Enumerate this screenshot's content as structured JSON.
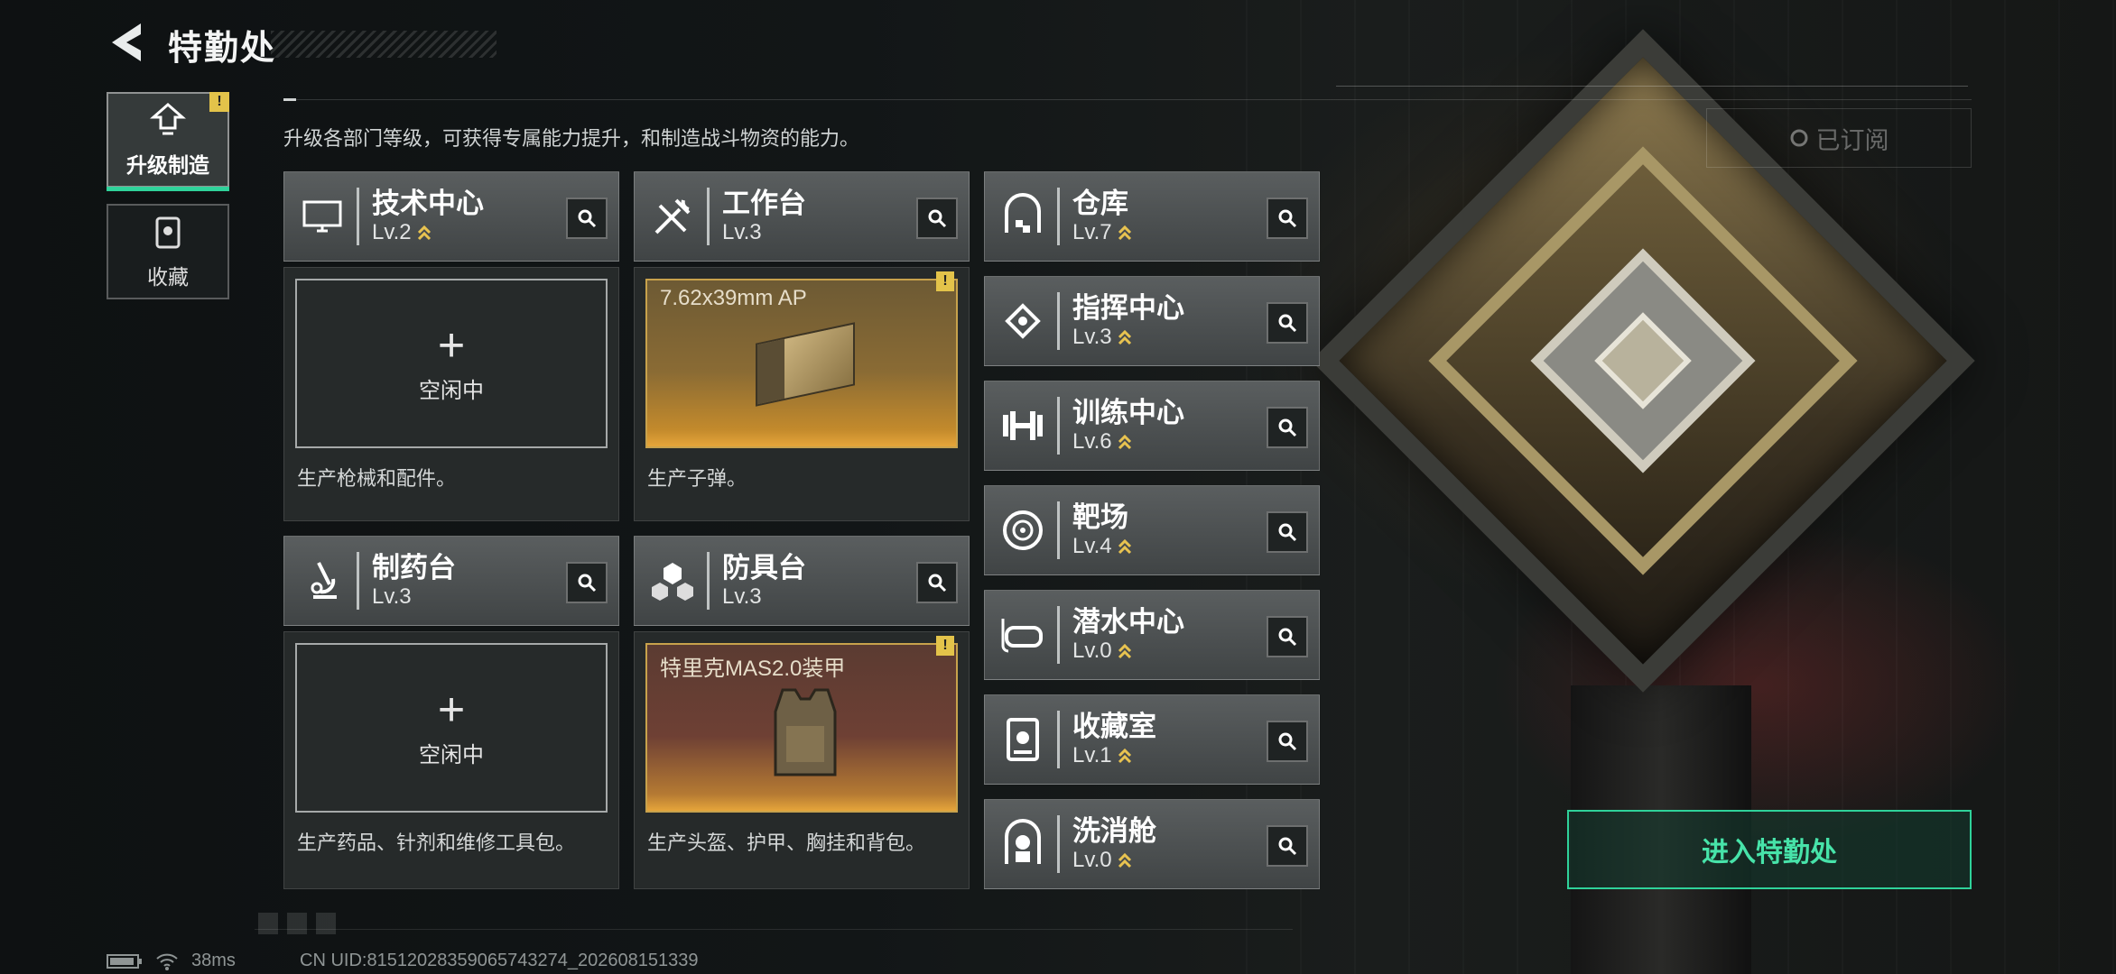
{
  "header": {
    "title": "特勤处"
  },
  "intro": "升级各部门等级，可获得专属能力提升，和制造战斗物资的能力。",
  "tabs": [
    {
      "label": "升级制造",
      "alert": "!"
    },
    {
      "label": "收藏"
    }
  ],
  "departments": [
    {
      "name": "技术中心",
      "level": "Lv.2",
      "idle_label": "空闲中",
      "desc": "生产枪械和配件。"
    },
    {
      "name": "工作台",
      "level": "Lv.3",
      "product": "7.62x39mm AP",
      "alert": "!",
      "desc": "生产子弹。"
    },
    {
      "name": "制药台",
      "level": "Lv.3",
      "idle_label": "空闲中",
      "desc": "生产药品、针剂和维修工具包。"
    },
    {
      "name": "防具台",
      "level": "Lv.3",
      "product": "特里克MAS2.0装甲",
      "alert": "!",
      "desc": "生产头盔、护甲、胸挂和背包。"
    }
  ],
  "facilities": [
    {
      "name": "仓库",
      "level": "Lv.7"
    },
    {
      "name": "指挥中心",
      "level": "Lv.3"
    },
    {
      "name": "训练中心",
      "level": "Lv.6"
    },
    {
      "name": "靶场",
      "level": "Lv.4"
    },
    {
      "name": "潜水中心",
      "level": "Lv.0"
    },
    {
      "name": "收藏室",
      "level": "Lv.1"
    },
    {
      "name": "洗消舱",
      "level": "Lv.0"
    }
  ],
  "subscribed_label": "已订阅",
  "enter_button": "进入特勤处",
  "status": {
    "ping": "38ms",
    "uid": "CN UID:8151202835906574327​4_202608151339"
  },
  "colors": {
    "accent": "#2fd29a",
    "alert": "#e3c34a",
    "production": "#e6a53a"
  }
}
